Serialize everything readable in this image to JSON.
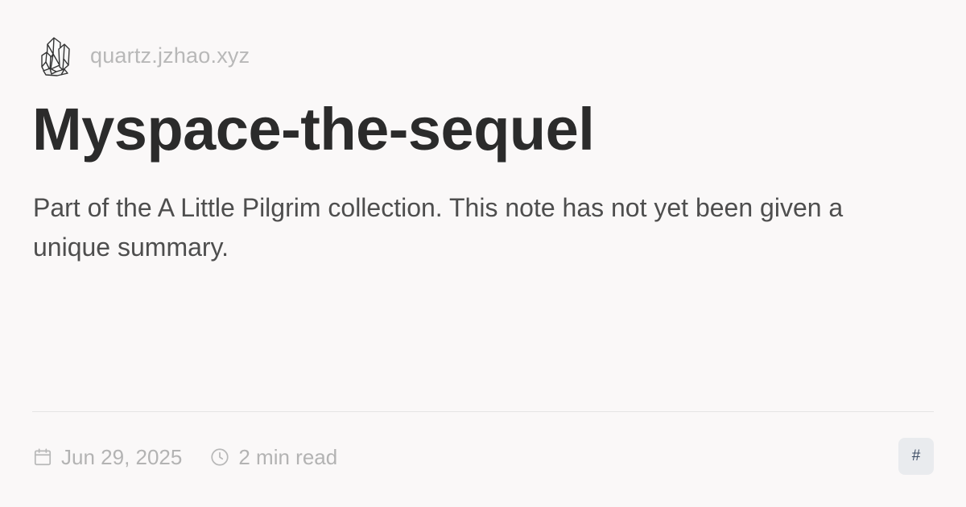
{
  "header": {
    "logo_icon": "crystal-cluster-icon",
    "site_url": "quartz.jzhao.xyz"
  },
  "page": {
    "title": "Myspace-the-sequel",
    "description": "Part of the A Little Pilgrim collection. This note has not yet been given a unique summary."
  },
  "meta": {
    "date_icon": "calendar-icon",
    "date": "Jun 29, 2025",
    "reading_icon": "clock-icon",
    "reading_time": "2 min read"
  },
  "tag": {
    "label": "#"
  },
  "colors": {
    "background": "#faf8f8",
    "title": "#2b2b2b",
    "muted": "#b3b3b3",
    "tag_background": "#e9ebee",
    "tag_text": "#3b4b63"
  }
}
